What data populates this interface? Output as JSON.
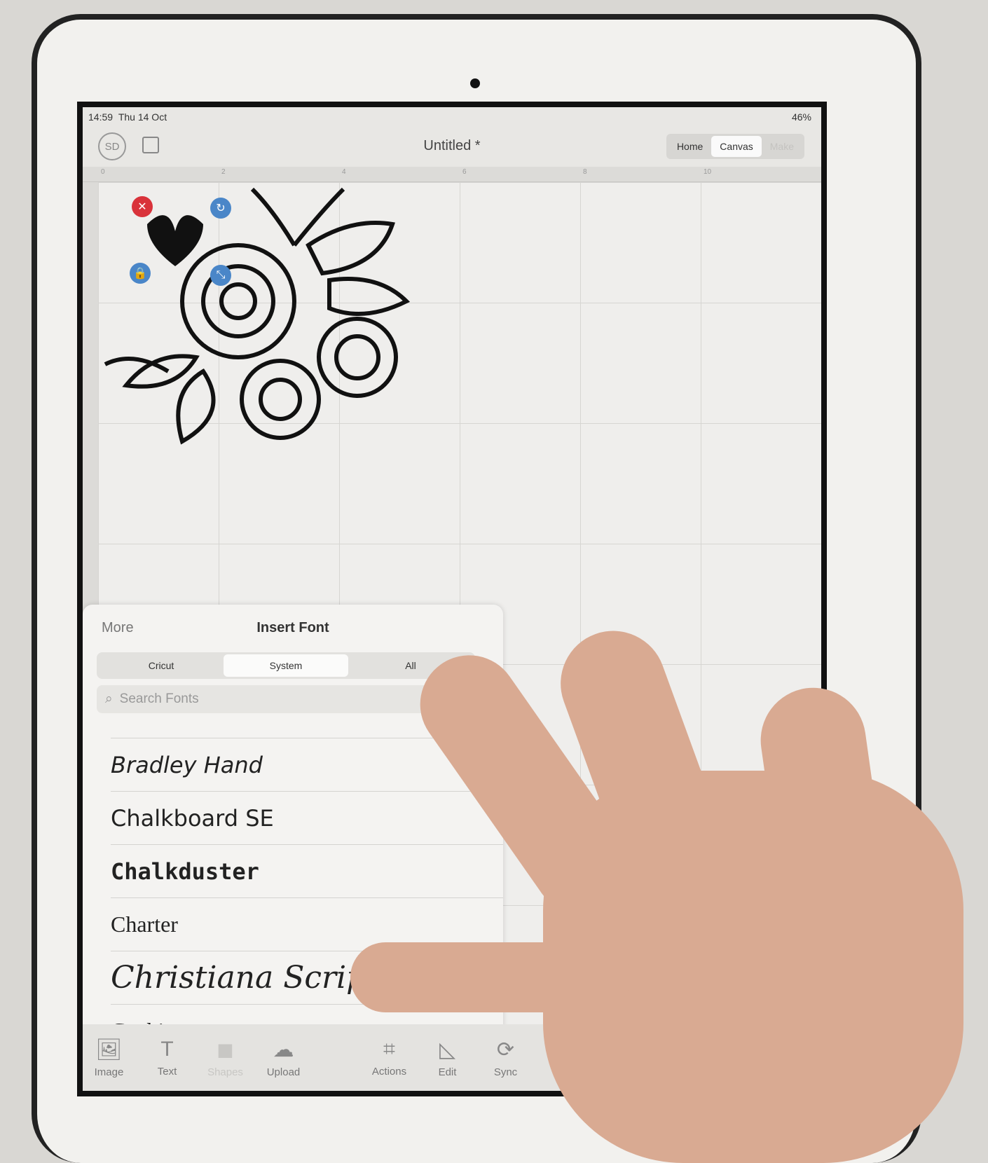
{
  "status": {
    "time": "14:59",
    "date": "Thu 14 Oct",
    "battery": "46%"
  },
  "header": {
    "avatar": "SD",
    "title": "Untitled *",
    "tabs": [
      {
        "label": "Home"
      },
      {
        "label": "Canvas",
        "active": true
      },
      {
        "label": "Make"
      }
    ]
  },
  "ruler": {
    "ticks": [
      "0",
      "2",
      "4",
      "6",
      "8",
      "10"
    ]
  },
  "panel": {
    "back_label": "More",
    "title": "Insert Font",
    "tabs": [
      {
        "label": "Cricut"
      },
      {
        "label": "System",
        "active": true
      },
      {
        "label": "All"
      }
    ],
    "search_placeholder": "Search Fonts",
    "fonts": [
      "Bradley Hand",
      "Chalkboard SE",
      "Chalkduster",
      "Charter",
      "Christiana Script",
      "Cochin"
    ]
  },
  "toolbar": {
    "items": [
      {
        "label": "Image",
        "icon": "image-add-icon"
      },
      {
        "label": "Text",
        "icon": "text-add-icon"
      },
      {
        "label": "Shapes",
        "icon": "shapes-icon",
        "disabled": true
      },
      {
        "label": "Upload",
        "icon": "upload-cloud-icon"
      },
      {
        "label": "Actions",
        "icon": "actions-icon"
      },
      {
        "label": "Edit",
        "icon": "edit-icon"
      },
      {
        "label": "Sync",
        "icon": "sync-icon"
      }
    ]
  },
  "colors": {
    "delete": "#d9323a",
    "handle": "#4a86c8"
  }
}
